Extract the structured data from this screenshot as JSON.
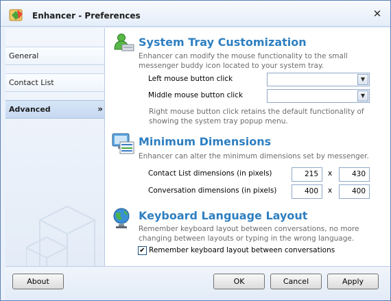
{
  "window": {
    "title": "Enhancer - Preferences",
    "close_glyph": "✕"
  },
  "sidebar": {
    "items": [
      {
        "label": "General"
      },
      {
        "label": "Contact List"
      },
      {
        "label": "Advanced",
        "chevron": "»"
      }
    ]
  },
  "tray": {
    "title": "System Tray Customization",
    "desc": "Enhancer can modify the mouse functionality to the small messenger buddy icon located to your system tray.",
    "left_label": "Left mouse button click",
    "left_value": "",
    "middle_label": "Middle mouse button click",
    "middle_value": "",
    "note": "Right mouse button click retains the default functionality of showing the system tray popup menu."
  },
  "dimensions": {
    "title": "Minimum Dimensions",
    "desc": "Enhancer can alter the minimum dimensions set by messenger.",
    "contact_label": "Contact List dimensions (in pixels)",
    "contact_w": "215",
    "contact_h": "430",
    "conv_label": "Conversation dimensions (in pixels)",
    "conv_w": "400",
    "conv_h": "400",
    "times": "x"
  },
  "keyboard": {
    "title": "Keyboard Language Layout",
    "desc": "Remember keyboard layout between conversations, no more changing between layouts or typing in the wrong language.",
    "checkbox_label": "Remember keyboard layout between conversations",
    "checked": true,
    "check_glyph": "✔"
  },
  "footer": {
    "about": "About",
    "ok": "OK",
    "cancel": "Cancel",
    "apply": "Apply"
  },
  "icons": [
    "app-icon",
    "buddy-icon",
    "monitor-icon",
    "globe-icon",
    "close-icon",
    "chevron-down-icon"
  ]
}
